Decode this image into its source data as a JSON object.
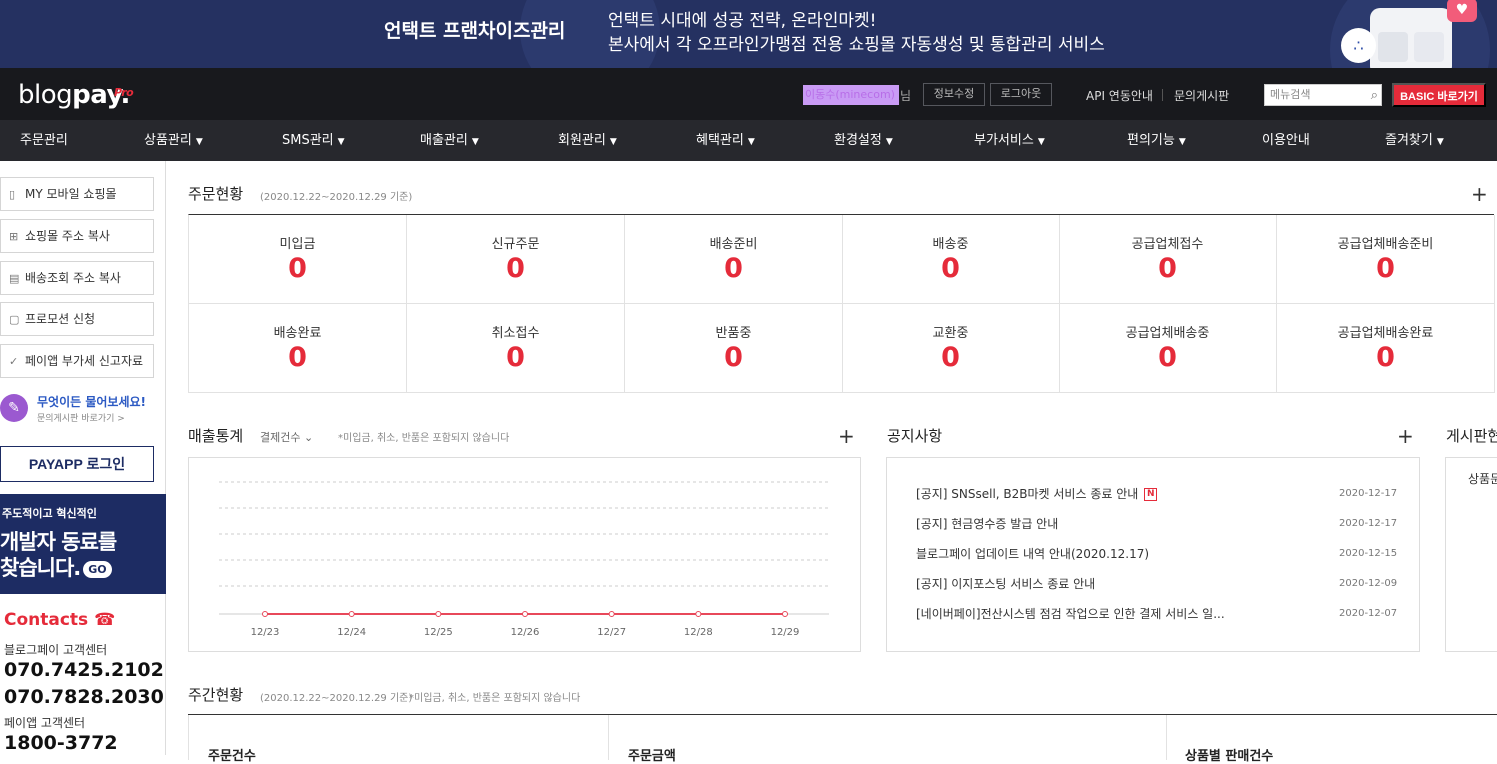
{
  "banner": {
    "title": "언택트 프랜차이즈관리",
    "line1": "언택트 시대에 성공 전략, 온라인마켓!",
    "line2": "본사에서 각 오프라인가맹점 전용 쇼핑몰 자동생성 및 통합관리 서비스"
  },
  "header": {
    "logo_light": "blog",
    "logo_bold": "pay.",
    "logo_pro": "Pro",
    "user_id": "이동수(minecom)",
    "user_suffix": "님",
    "edit_info": "정보수정",
    "logout": "로그아웃",
    "api_guide": "API 연동안내",
    "board_link": "문의게시판",
    "menu_search_placeholder": "메뉴검색",
    "basic_button": "BASIC 바로가기"
  },
  "nav": [
    {
      "label": "주문관리",
      "caret": false
    },
    {
      "label": "상품관리",
      "caret": true
    },
    {
      "label": "SMS관리",
      "caret": true
    },
    {
      "label": "매출관리",
      "caret": true
    },
    {
      "label": "회원관리",
      "caret": true
    },
    {
      "label": "혜택관리",
      "caret": true
    },
    {
      "label": "환경설정",
      "caret": true
    },
    {
      "label": "부가서비스",
      "caret": true
    },
    {
      "label": "편의기능",
      "caret": true
    },
    {
      "label": "이용안내",
      "caret": false
    },
    {
      "label": "즐겨찾기",
      "caret": true
    }
  ],
  "sidebar": {
    "buttons": [
      {
        "label": "MY 모바일 쇼핑몰",
        "icon": "mobile-icon"
      },
      {
        "label": "쇼핑몰 주소 복사",
        "icon": "copy-icon"
      },
      {
        "label": "배송조회 주소 복사",
        "icon": "copy-icon"
      },
      {
        "label": "프로모션 신청",
        "icon": "document-icon"
      },
      {
        "label": "페이앱 부가세 신고자료",
        "icon": "check-circle-icon"
      }
    ],
    "ask_title": "무엇이든 물어보세요!",
    "ask_sub": "문의게시판 바로가기 >",
    "payapp_login": "PAYAPP 로그인",
    "dev_line1": "주도적이고 혁신적인",
    "dev_line2": "개발자 동료를",
    "dev_line3": "찾습니다.",
    "dev_go": "GO",
    "contacts_title": "Contacts",
    "blogpay_center": "블로그페이 고객센터",
    "phone1": "070.7425.2102",
    "phone2": "070.7828.2030",
    "payapp_center": "페이앱 고객센터",
    "phone3": "1800-3772"
  },
  "order_status": {
    "title": "주문현황",
    "period": "(2020.12.22~2020.12.29 기준)",
    "cells": [
      {
        "label": "미입금",
        "value": "0"
      },
      {
        "label": "신규주문",
        "value": "0"
      },
      {
        "label": "배송준비",
        "value": "0"
      },
      {
        "label": "배송중",
        "value": "0"
      },
      {
        "label": "공급업체접수",
        "value": "0"
      },
      {
        "label": "공급업체배송준비",
        "value": "0"
      },
      {
        "label": "배송완료",
        "value": "0"
      },
      {
        "label": "취소접수",
        "value": "0"
      },
      {
        "label": "반품중",
        "value": "0"
      },
      {
        "label": "교환중",
        "value": "0"
      },
      {
        "label": "공급업체배송중",
        "value": "0"
      },
      {
        "label": "공급업체배송완료",
        "value": "0"
      }
    ]
  },
  "sales": {
    "title": "매출통계",
    "filter": "결제건수",
    "note": "*미입금, 취소, 반품은 포함되지 않습니다"
  },
  "chart_data": {
    "type": "line",
    "categories": [
      "12/23",
      "12/24",
      "12/25",
      "12/26",
      "12/27",
      "12/28",
      "12/29"
    ],
    "values": [
      0,
      0,
      0,
      0,
      0,
      0,
      0
    ],
    "grid": true,
    "color": "#e8485a"
  },
  "notice": {
    "title": "공지사항",
    "items": [
      {
        "text": "[공지] SNSsell, B2B마켓 서비스 종료 안내",
        "date": "2020-12-17",
        "new": true,
        "new_label": "N"
      },
      {
        "text": "[공지] 현금영수증 발급 안내",
        "date": "2020-12-17",
        "new": false
      },
      {
        "text": "블로그페이 업데이트 내역 안내(2020.12.17)",
        "date": "2020-12-15",
        "new": false
      },
      {
        "text": "[공지] 이지포스팅 서비스 종료 안내",
        "date": "2020-12-09",
        "new": false
      },
      {
        "text": "[네이버페이]전산시스템 점검 작업으로 인한 결제 서비스 일...",
        "date": "2020-12-07",
        "new": false
      }
    ]
  },
  "board": {
    "title": "게시판현",
    "item": "상품문"
  },
  "weekly": {
    "title": "주간현황",
    "period": "(2020.12.22~2020.12.29 기준)",
    "note": "*미입금, 취소, 반품은 포함되지 않습니다",
    "columns": [
      "주문건수",
      "주문금액",
      "상품별 판매건수"
    ]
  },
  "colors": {
    "accent": "#e52b3a",
    "banner_bg": "#253161",
    "topbar_bg": "#18191d",
    "nav_bg": "#27282d",
    "link_blue": "#2b59c3"
  }
}
